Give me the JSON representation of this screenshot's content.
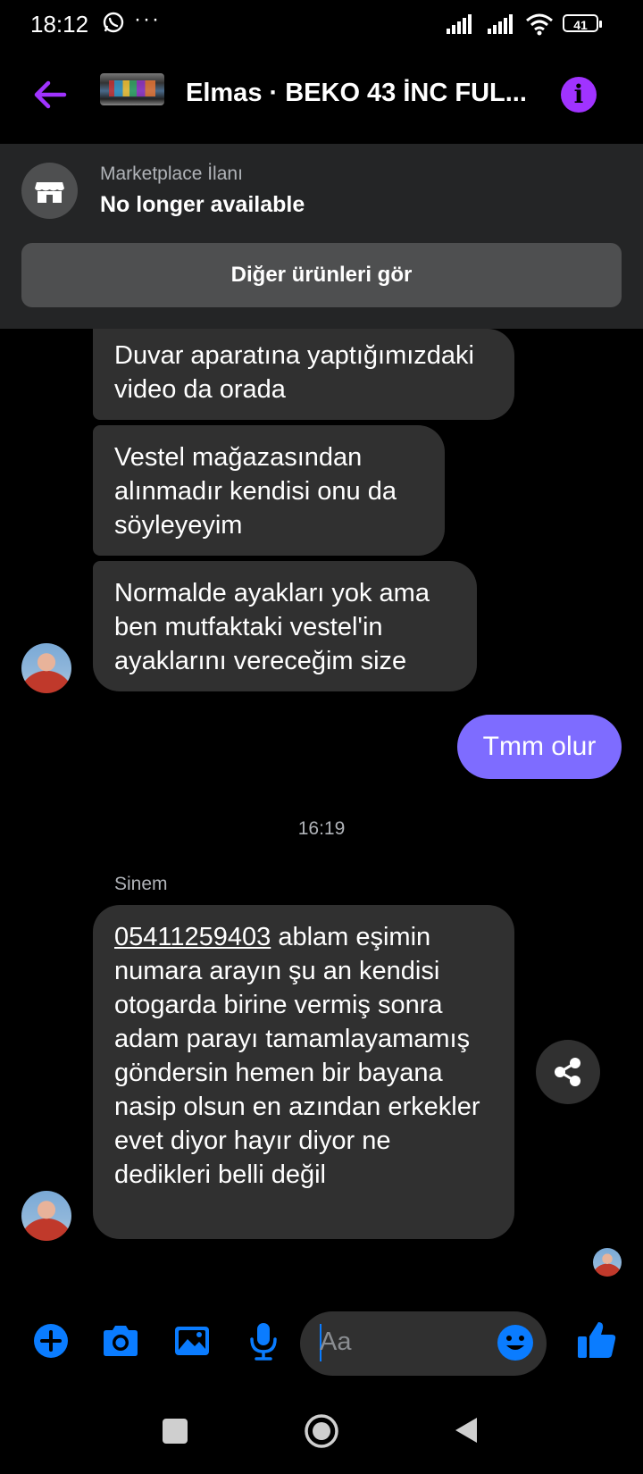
{
  "status_bar": {
    "time": "18:12",
    "more": "···",
    "battery": "41"
  },
  "header": {
    "title": "Elmas · BEKO 43 İNC FUL..."
  },
  "marketplace": {
    "label": "Marketplace İlanı",
    "status": "No longer available",
    "button_label": "Diğer ürünleri gör"
  },
  "messages": {
    "m1": "Duvar aparatına yaptığımızdaki video da orada",
    "m2": "Vestel mağazasından alınmadır kendisi onu da söyleyeyim",
    "m3": "Normalde ayakları yok ama ben mutfaktaki vestel'in ayaklarını vereceğim size",
    "mine": "Tmm olur",
    "timestamp": "16:19",
    "sender": "Sinem",
    "m4_phone": "05411259403",
    "m4_text": " ablam eşimin numara arayın şu an kendisi otogarda birine vermiş sonra adam parayı tamamlayamamış göndersin hemen bir bayana nasip olsun en azından erkekler evet diyor hayır diyor ne dedikleri belli değil"
  },
  "composer": {
    "placeholder": "Aa"
  },
  "colors": {
    "accent": "#a033ff",
    "my_bubble": "#7e6cff",
    "their_bubble": "#303030",
    "icon_blue": "#0a7cff"
  },
  "icons": {
    "back": "arrow-left-icon",
    "info": "info-icon",
    "store": "store-icon",
    "share": "share-icon",
    "plus": "plus-circle-icon",
    "camera": "camera-icon",
    "image": "image-icon",
    "mic": "microphone-icon",
    "emoji": "emoji-icon",
    "like": "thumbs-up-icon"
  }
}
